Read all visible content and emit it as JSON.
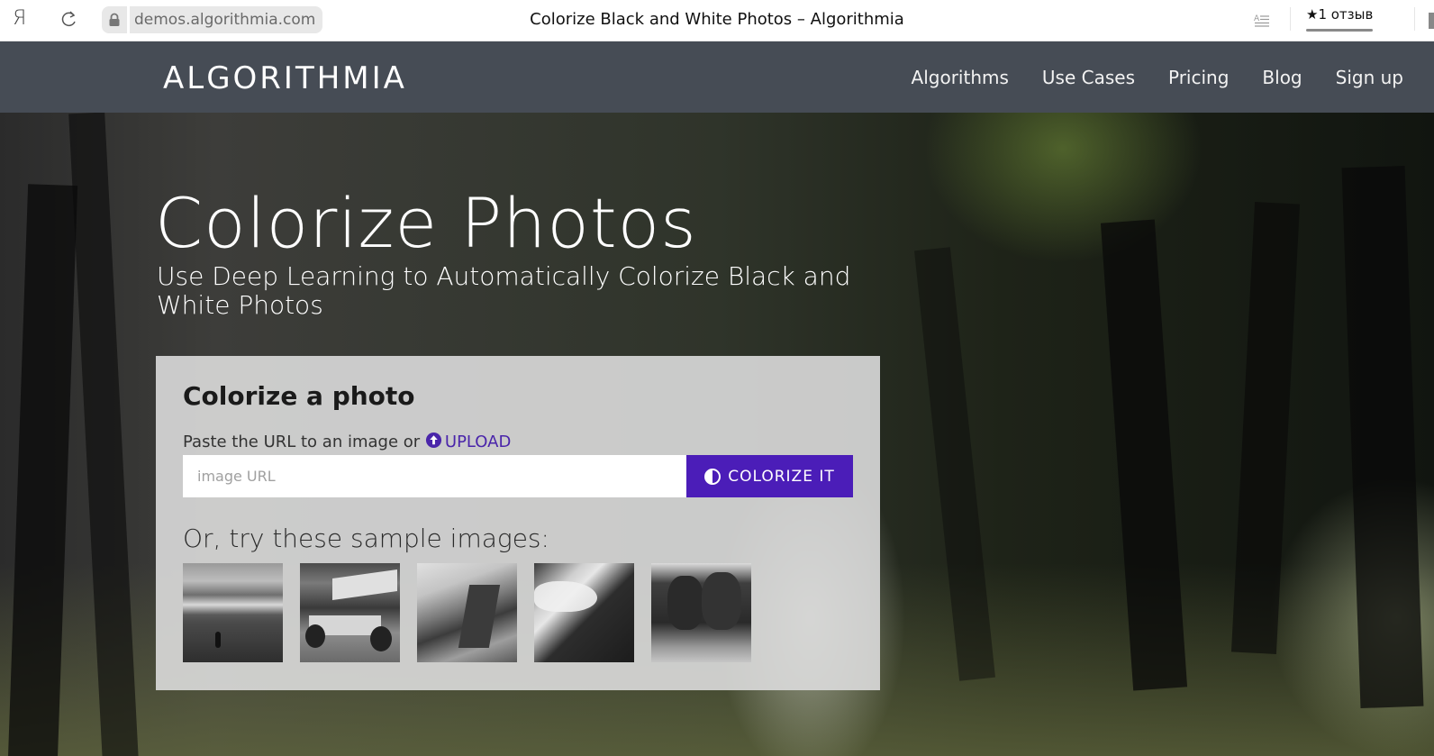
{
  "browser": {
    "logo_glyph": "Я",
    "url": "demos.algorithmia.com",
    "tab_title": "Colorize Black and White Photos – Algorithmia",
    "review_label": "★1 отзыв"
  },
  "site": {
    "logo": "ALGORITHMIA",
    "nav": [
      {
        "label": "Algorithms"
      },
      {
        "label": "Use Cases"
      },
      {
        "label": "Pricing"
      },
      {
        "label": "Blog"
      },
      {
        "label": "Sign up"
      }
    ]
  },
  "hero": {
    "title": "Colorize Photos",
    "subtitle": "Use Deep Learning to Automatically Colorize Black and White Photos"
  },
  "card": {
    "title": "Colorize a photo",
    "url_prompt": "Paste the URL to an image or",
    "upload_label": "UPLOAD",
    "input_value": "",
    "input_placeholder": "image URL",
    "button_label": "COLORIZE IT",
    "samples_label": "Or, try these sample images:",
    "samples": [
      {
        "subject": "heron wading in water"
      },
      {
        "subject": "sprint race car #88"
      },
      {
        "subject": "half dome mountain"
      },
      {
        "subject": "fire breather"
      },
      {
        "subject": "cows in grass"
      }
    ]
  },
  "colors": {
    "nav_bg": "#464c55",
    "accent": "#4b1db8",
    "link": "#4a25aa"
  }
}
